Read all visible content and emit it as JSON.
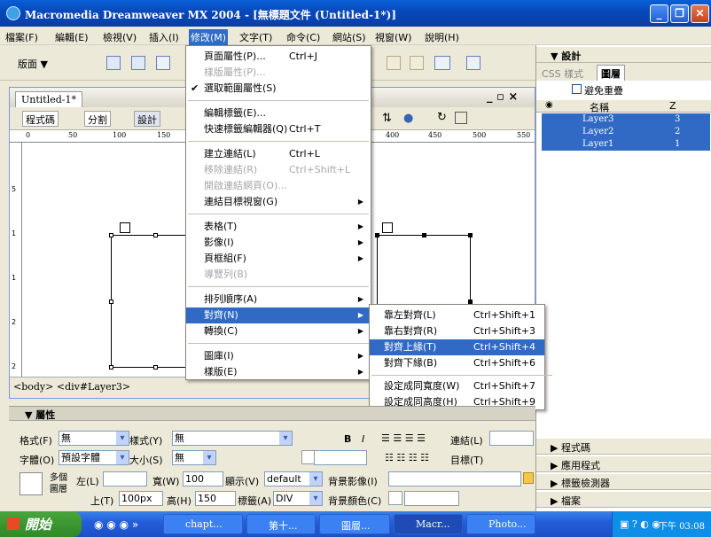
{
  "window": {
    "title": "Macromedia Dreamweaver MX 2004 - [無標題文件 (Untitled-1*)]",
    "min": "_",
    "max": "❐",
    "close": "✕"
  },
  "menubar": [
    "檔案(F)",
    "編輯(E)",
    "檢視(V)",
    "插入(I)",
    "修改(M)",
    "文字(T)",
    "命令(C)",
    "網站(S)",
    "視窗(W)",
    "說明(H)"
  ],
  "toolbar": {
    "layout_label": "版面 ▼"
  },
  "doc": {
    "tab": "Untitled-1*",
    "controls": "_ ▫ ×",
    "views": {
      "code": "程式碼",
      "split": "分割",
      "design": "設計"
    },
    "ruler_ticks": [
      "0",
      "50",
      "100",
      "150",
      "400",
      "450",
      "500",
      "550"
    ],
    "vruler_ticks": [
      "5",
      "1",
      "1",
      "2",
      "2"
    ],
    "status": "<body> <div#Layer3>"
  },
  "menu": {
    "items": [
      {
        "label": "頁面屬性(P)...",
        "shortcut": "Ctrl+J",
        "state": "normal"
      },
      {
        "label": "樣版屬性(P)...",
        "shortcut": "",
        "state": "disabled"
      },
      {
        "label": "選取範圍屬性(S)",
        "shortcut": "",
        "state": "checked"
      },
      {
        "label": "編輯標籤(E)...",
        "shortcut": "",
        "state": "normal"
      },
      {
        "label": "快速標籤編輯器(Q)",
        "shortcut": "Ctrl+T",
        "state": "normal"
      },
      {
        "label": "建立連結(L)",
        "shortcut": "Ctrl+L",
        "state": "normal"
      },
      {
        "label": "移除連結(R)",
        "shortcut": "Ctrl+Shift+L",
        "state": "disabled"
      },
      {
        "label": "開啟連結網頁(O)...",
        "shortcut": "",
        "state": "disabled"
      },
      {
        "label": "連結目標視窗(G)",
        "shortcut": "",
        "state": "sub"
      },
      {
        "label": "表格(T)",
        "shortcut": "",
        "state": "sub"
      },
      {
        "label": "影像(I)",
        "shortcut": "",
        "state": "sub"
      },
      {
        "label": "頁框組(F)",
        "shortcut": "",
        "state": "sub"
      },
      {
        "label": "導覽列(B)",
        "shortcut": "",
        "state": "disabled"
      },
      {
        "label": "排列順序(A)",
        "shortcut": "",
        "state": "sub"
      },
      {
        "label": "對齊(N)",
        "shortcut": "",
        "state": "highlight"
      },
      {
        "label": "轉換(C)",
        "shortcut": "",
        "state": "sub"
      },
      {
        "label": "圖庫(I)",
        "shortcut": "",
        "state": "sub"
      },
      {
        "label": "樣版(E)",
        "shortcut": "",
        "state": "sub"
      }
    ]
  },
  "submenu": {
    "items": [
      {
        "label": "靠左對齊(L)",
        "shortcut": "Ctrl+Shift+1",
        "state": "normal"
      },
      {
        "label": "靠右對齊(R)",
        "shortcut": "Ctrl+Shift+3",
        "state": "normal"
      },
      {
        "label": "對齊上緣(T)",
        "shortcut": "Ctrl+Shift+4",
        "state": "highlight"
      },
      {
        "label": "對齊下緣(B)",
        "shortcut": "Ctrl+Shift+6",
        "state": "normal"
      },
      {
        "label": "設定成同寬度(W)",
        "shortcut": "Ctrl+Shift+7",
        "state": "normal"
      },
      {
        "label": "設定成同高度(H)",
        "shortcut": "Ctrl+Shift+9",
        "state": "normal"
      }
    ]
  },
  "panel": {
    "design_header": "▼ 設計",
    "tabs": [
      "CSS 樣式",
      "圖層"
    ],
    "prevent_overlap": "避免重疊",
    "col_name": "名稱",
    "col_z": "Z",
    "layers": [
      {
        "name": "Layer3",
        "z": "3"
      },
      {
        "name": "Layer2",
        "z": "2"
      },
      {
        "name": "Layer1",
        "z": "1"
      }
    ],
    "collapsed": [
      "▶ 程式碼",
      "▶ 應用程式",
      "▶ 標籤檢測器",
      "▶ 檔案"
    ]
  },
  "props": {
    "header": "▼ 屬性",
    "format_label": "格式(F)",
    "format_value": "無",
    "style_label": "樣式(Y)",
    "style_value": "無",
    "link_label": "連結(L)",
    "font_label": "字體(O)",
    "font_value": "預設字體",
    "size_label": "大小(S)",
    "size_value": "無",
    "target_label": "目標(T)",
    "multi_layers": "多個圖層",
    "left_label": "左(L)",
    "left_value": "",
    "width_label": "寬(W)",
    "width_value": "100",
    "vis_label": "顯示(V)",
    "vis_value": "default",
    "bgimg_label": "背景影像(I)",
    "top_label": "上(T)",
    "top_value": "100px",
    "height_label": "高(H)",
    "height_value": "150",
    "tag_label": "標籤(A)",
    "tag_value": "DIV",
    "bgcolor_label": "背景顏色(C)",
    "bold": "B",
    "italic": "I"
  },
  "taskbar": {
    "start": "開始",
    "buttons": [
      "chapt...",
      "第十...",
      "圖層...",
      "Macr...",
      "Photo..."
    ],
    "clock": "下午 03:08"
  }
}
